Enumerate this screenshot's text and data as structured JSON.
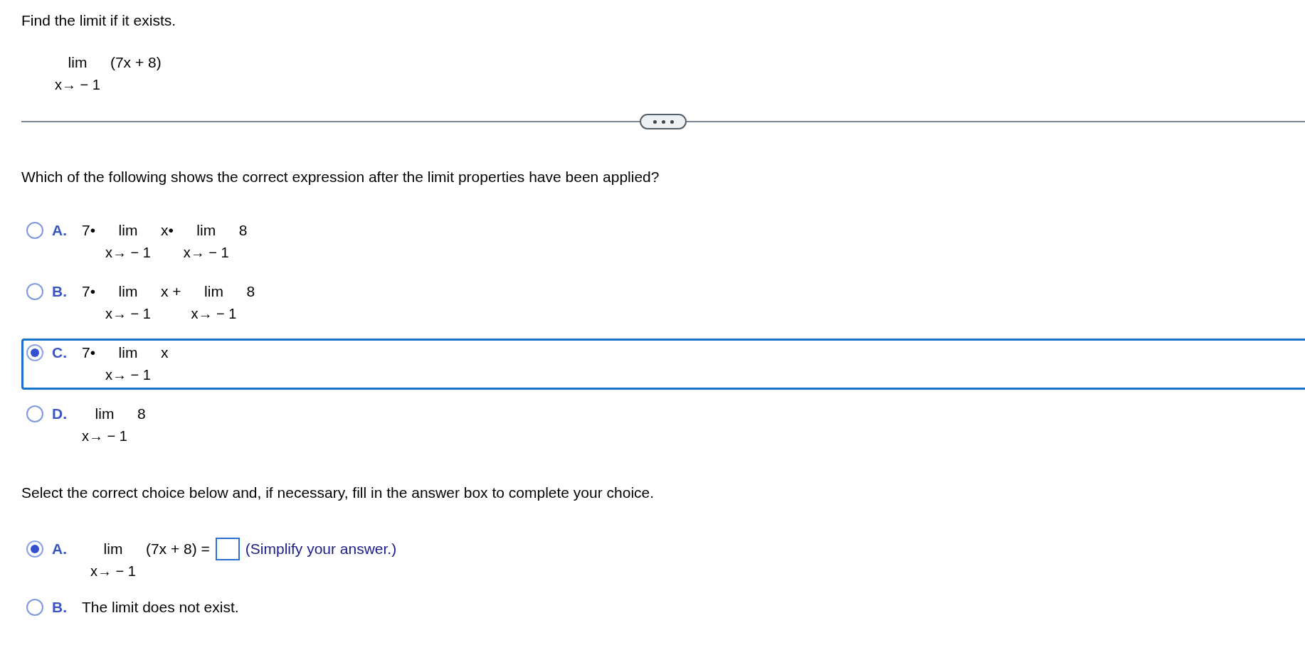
{
  "prompt": "Find the limit if it exists.",
  "expression": [
    {
      "kind": "limit",
      "operator": "lim",
      "under": "x→ − 1"
    },
    {
      "kind": "text",
      "text": "(7x + 8)"
    }
  ],
  "question": "Which of the following shows the correct expression after the limit properties have been applied?",
  "choices": [
    {
      "letter": "A.",
      "selected": false,
      "parts": [
        {
          "kind": "text",
          "text": "7•"
        },
        {
          "kind": "limit",
          "operator": "lim",
          "under": "x→ − 1"
        },
        {
          "kind": "text",
          "text": "x•"
        },
        {
          "kind": "limit",
          "operator": "lim",
          "under": "x→ − 1"
        },
        {
          "kind": "text",
          "text": "8"
        }
      ]
    },
    {
      "letter": "B.",
      "selected": false,
      "parts": [
        {
          "kind": "text",
          "text": "7•"
        },
        {
          "kind": "limit",
          "operator": "lim",
          "under": "x→ − 1"
        },
        {
          "kind": "text",
          "text": "x +"
        },
        {
          "kind": "limit",
          "operator": "lim",
          "under": "x→ − 1"
        },
        {
          "kind": "text",
          "text": "8"
        }
      ]
    },
    {
      "letter": "C.",
      "selected": true,
      "parts": [
        {
          "kind": "text",
          "text": "7•"
        },
        {
          "kind": "limit",
          "operator": "lim",
          "under": "x→ − 1"
        },
        {
          "kind": "text",
          "text": "x"
        }
      ]
    },
    {
      "letter": "D.",
      "selected": false,
      "parts": [
        {
          "kind": "limit",
          "operator": "lim",
          "under": "x→ − 1"
        },
        {
          "kind": "text",
          "text": "8"
        }
      ]
    }
  ],
  "instruction": "Select the correct choice below and, if necessary, fill in the answer box to complete your choice.",
  "answers": [
    {
      "letter": "A.",
      "selected": true,
      "kind": "fill",
      "parts": [
        {
          "kind": "limit",
          "operator": "lim",
          "under": "x→ − 1"
        },
        {
          "kind": "text",
          "text": "(7x + 8) ="
        }
      ],
      "hint": "(Simplify your answer.)"
    },
    {
      "letter": "B.",
      "selected": false,
      "kind": "statement",
      "text": "The limit does not exist."
    }
  ]
}
